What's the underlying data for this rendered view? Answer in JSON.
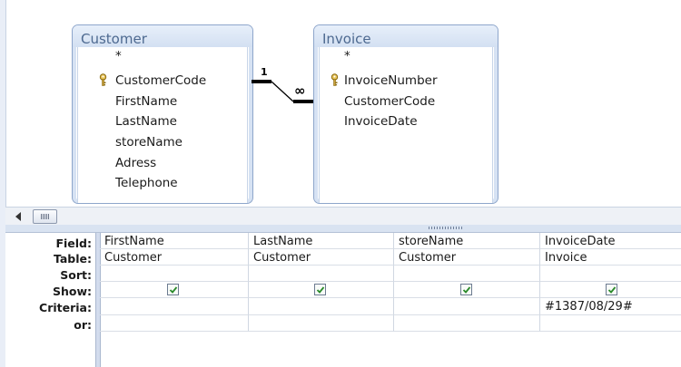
{
  "tables": [
    {
      "name": "Customer",
      "fields": [
        "*",
        "CustomerCode",
        "FirstName",
        "LastName",
        "storeName",
        "Adress",
        "Telephone"
      ],
      "primary_key": "CustomerCode"
    },
    {
      "name": "Invoice",
      "fields": [
        "*",
        "InvoiceNumber",
        "CustomerCode",
        "InvoiceDate"
      ],
      "primary_key": "InvoiceNumber"
    }
  ],
  "relationship": {
    "one_label": "1",
    "many_label": "∞"
  },
  "grid": {
    "row_labels": [
      "Field:",
      "Table:",
      "Sort:",
      "Show:",
      "Criteria:",
      "or:"
    ],
    "columns": [
      {
        "field": "FirstName",
        "table": "Customer",
        "sort": "",
        "show": true,
        "criteria": "",
        "or": ""
      },
      {
        "field": "LastName",
        "table": "Customer",
        "sort": "",
        "show": true,
        "criteria": "",
        "or": ""
      },
      {
        "field": "storeName",
        "table": "Customer",
        "sort": "",
        "show": true,
        "criteria": "",
        "or": ""
      },
      {
        "field": "InvoiceDate",
        "table": "Invoice",
        "sort": "",
        "show": true,
        "criteria": "#1387/08/29#",
        "or": ""
      }
    ]
  },
  "colors": {
    "title_text": "#4d6990",
    "box_border": "#8ea6cb",
    "check": "#2a8a2a"
  },
  "icons": {
    "key": "primary-key-icon",
    "checkbox": "checkbox-checked-icon",
    "scroll_left": "scroll-left-arrow-icon"
  }
}
